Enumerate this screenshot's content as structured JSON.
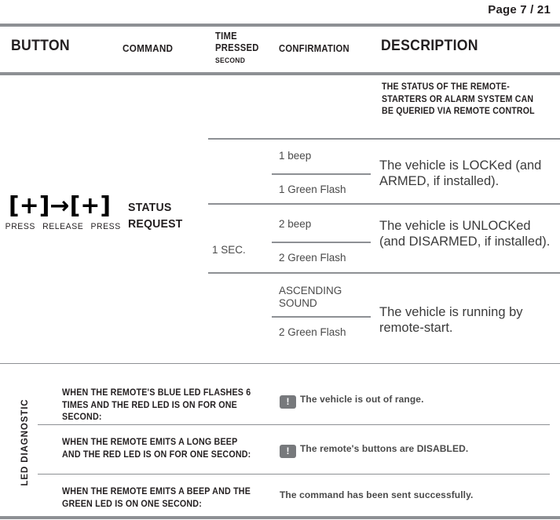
{
  "page": {
    "page_label": "Page 7 / 21"
  },
  "table": {
    "headers": {
      "button": "BUTTON",
      "command": "COMMAND",
      "time_pressed": "TIME PRESSED",
      "time_pressed_line1": "TIME",
      "time_pressed_line2": "PRESSED",
      "time_unit": "SECOND",
      "confirmation": "CONFIRMATION",
      "description": "DESCRIPTION"
    },
    "row": {
      "button_glyph": "(+)→(+)",
      "button_glyph_parts": [
        "[+]",
        "→",
        "[+]"
      ],
      "button_legend": [
        "PRESS",
        "RELEASE",
        "PRESS"
      ],
      "command": "STATUS REQUEST",
      "time_pressed": "1 SEC.",
      "intro_description": "THE STATUS OF THE REMOTE-STARTERS OR ALARM SYSTEM CAN BE QUERIED VIA REMOTE CONTROL",
      "entries": [
        {
          "confirmation_top": "1 beep",
          "confirmation_bottom": "1 Green Flash",
          "description": "The vehicle is LOCKed (and ARMED, if installed)."
        },
        {
          "confirmation_top": "2 beep",
          "confirmation_bottom": "2 Green Flash",
          "description": "The vehicle is UNLOCKed (and DISARMED, if installed)."
        },
        {
          "confirmation_top": "ASCENDING SOUND",
          "confirmation_bottom": "2 Green Flash",
          "description": "The vehicle is running by remote-start."
        }
      ]
    }
  },
  "led_diagnostic": {
    "section_label": "LED DIAGNOSTIC",
    "rows": [
      {
        "condition": "WHEN THE REMOTE'S BLUE LED FLASHES 6 TIMES AND THE RED LED IS ON FOR ONE SECOND:",
        "icon": "warning-icon",
        "icon_glyph": "!",
        "result": "The vehicle is out of range."
      },
      {
        "condition": "WHEN THE REMOTE EMITS A LONG BEEP AND THE RED LED IS ON FOR ONE SECOND:",
        "icon": "warning-icon",
        "icon_glyph": "!",
        "result": "The remote's buttons are DISABLED."
      },
      {
        "condition": "WHEN THE REMOTE EMITS A BEEP AND THE GREEN LED IS ON ONE SECOND:",
        "icon": null,
        "icon_glyph": "",
        "result": "The command has been sent successfully."
      }
    ]
  },
  "colors": {
    "rule": "#8d9094",
    "text_dark": "#231f20",
    "text_gray": "#4a4a4a",
    "icon_bg": "#77797c"
  }
}
